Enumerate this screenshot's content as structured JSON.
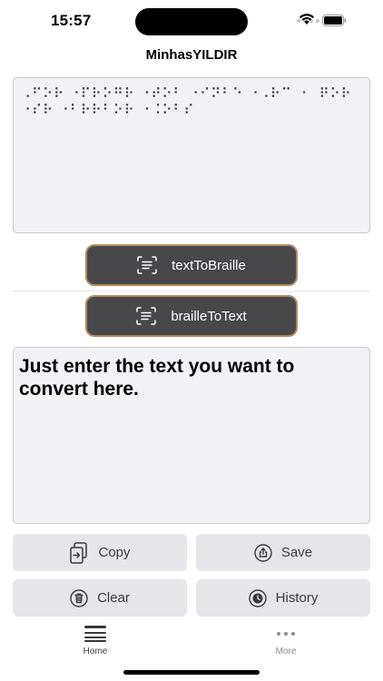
{
  "status": {
    "time": "15:57"
  },
  "nav": {
    "title": "MinhasYILDIR"
  },
  "braille_output": {
    "value": "⠠⠋⠕⠗ ⠐⠏⠗⠕⠛⠗ ⠐⠞⠕⠃ ⠐⠊⠝⠃⠑ ⠐⠠⠗⠉ ⠐⠀⠟⠕⠗ ⠐⠎⠗ ⠐⠃⠗⠗⠃⠕⠗ ⠐⠨⠕⠃⠎"
  },
  "convert": {
    "text_to_braille_label": "textToBraille",
    "braille_to_text_label": "brailleToText"
  },
  "text_input": {
    "value": "Just enter the text you want to convert here."
  },
  "actions": {
    "copy_label": "Copy",
    "save_label": "Save",
    "clear_label": "Clear",
    "history_label": "History"
  },
  "tabbar": {
    "home_label": "Home",
    "more_label": "More"
  },
  "colors": {
    "convert_bg": "#48484a",
    "convert_border": "#b28a5f",
    "action_bg": "#e5e5ea",
    "field_bg": "#f2f1f6"
  },
  "icons": {
    "convert": "doc-text-viewfinder-icon",
    "copy": "doc-on-doc-icon",
    "save": "square-and-arrow-up-circle-icon",
    "clear": "trash-circle-icon",
    "history": "clock-circle-icon",
    "home": "list-icon",
    "more": "ellipsis-icon"
  }
}
